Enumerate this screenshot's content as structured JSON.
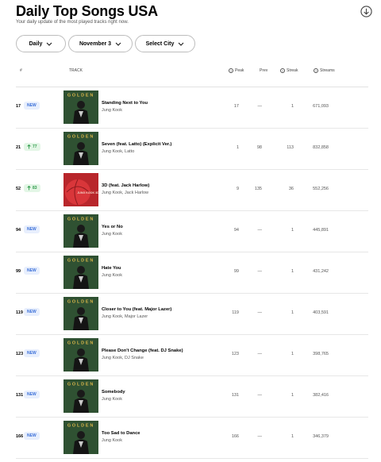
{
  "header": {
    "title": "Daily Top Songs USA",
    "subtitle": "Your daily update of the most played tracks right now."
  },
  "filters": {
    "period": "Daily",
    "date": "November 3",
    "city": "Select City"
  },
  "columns": {
    "rank": "#",
    "track": "TRACK",
    "peak": "Peak",
    "prev": "Prev",
    "streak": "Streak",
    "streams": "Streams"
  },
  "rows": [
    {
      "rank": "17",
      "badge": "NEW",
      "badge_type": "new",
      "cover": "golden",
      "title": "Standing Next to You",
      "artists": "Jung Kook",
      "peak": "17",
      "prev": "—",
      "streak": "1",
      "streams": "671,093"
    },
    {
      "rank": "21",
      "badge": "77",
      "badge_type": "up",
      "cover": "golden",
      "title": "Seven (feat. Latto) (Explicit Ver.)",
      "artists": "Jung Kook, Latto",
      "peak": "1",
      "prev": "98",
      "streak": "113",
      "streams": "832,858"
    },
    {
      "rank": "52",
      "badge": "83",
      "badge_type": "up",
      "cover": "3d",
      "title": "3D (feat. Jack Harlow)",
      "artists": "Jung Kook, Jack Harlow",
      "peak": "9",
      "prev": "135",
      "streak": "36",
      "streams": "552,256"
    },
    {
      "rank": "94",
      "badge": "NEW",
      "badge_type": "new",
      "cover": "golden",
      "title": "Yes or No",
      "artists": "Jung Kook",
      "peak": "94",
      "prev": "—",
      "streak": "1",
      "streams": "445,891"
    },
    {
      "rank": "99",
      "badge": "NEW",
      "badge_type": "new",
      "cover": "golden",
      "title": "Hate You",
      "artists": "Jung Kook",
      "peak": "99",
      "prev": "—",
      "streak": "1",
      "streams": "431,242"
    },
    {
      "rank": "119",
      "badge": "NEW",
      "badge_type": "new",
      "cover": "golden",
      "title": "Closer to You (feat. Major Lazer)",
      "artists": "Jung Kook, Major Lazer",
      "peak": "119",
      "prev": "—",
      "streak": "1",
      "streams": "403,591"
    },
    {
      "rank": "123",
      "badge": "NEW",
      "badge_type": "new",
      "cover": "golden",
      "title": "Please Don't Change (feat. DJ Snake)",
      "artists": "Jung Kook, DJ Snake",
      "peak": "123",
      "prev": "—",
      "streak": "1",
      "streams": "398,765"
    },
    {
      "rank": "131",
      "badge": "NEW",
      "badge_type": "new",
      "cover": "golden",
      "title": "Somebody",
      "artists": "Jung Kook",
      "peak": "131",
      "prev": "—",
      "streak": "1",
      "streams": "382,416"
    },
    {
      "rank": "166",
      "badge": "NEW",
      "badge_type": "new",
      "cover": "golden",
      "title": "Too Sad to Dance",
      "artists": "Jung Kook",
      "peak": "166",
      "prev": "—",
      "streak": "1",
      "streams": "346,379"
    }
  ],
  "covers": {
    "golden": {
      "text": "GOLDEN",
      "bg": "#2f5132",
      "text_color": "#d9b64a"
    },
    "3d": {
      "text": "JUNG KOOK 3D",
      "bg": "#b8262b",
      "text_color": "#f2d1c4"
    }
  },
  "icons": {
    "download": "download-circle-icon",
    "chevron": "chevron-down-icon",
    "info": "info-question-icon",
    "trend_up": "arrow-up-icon"
  }
}
